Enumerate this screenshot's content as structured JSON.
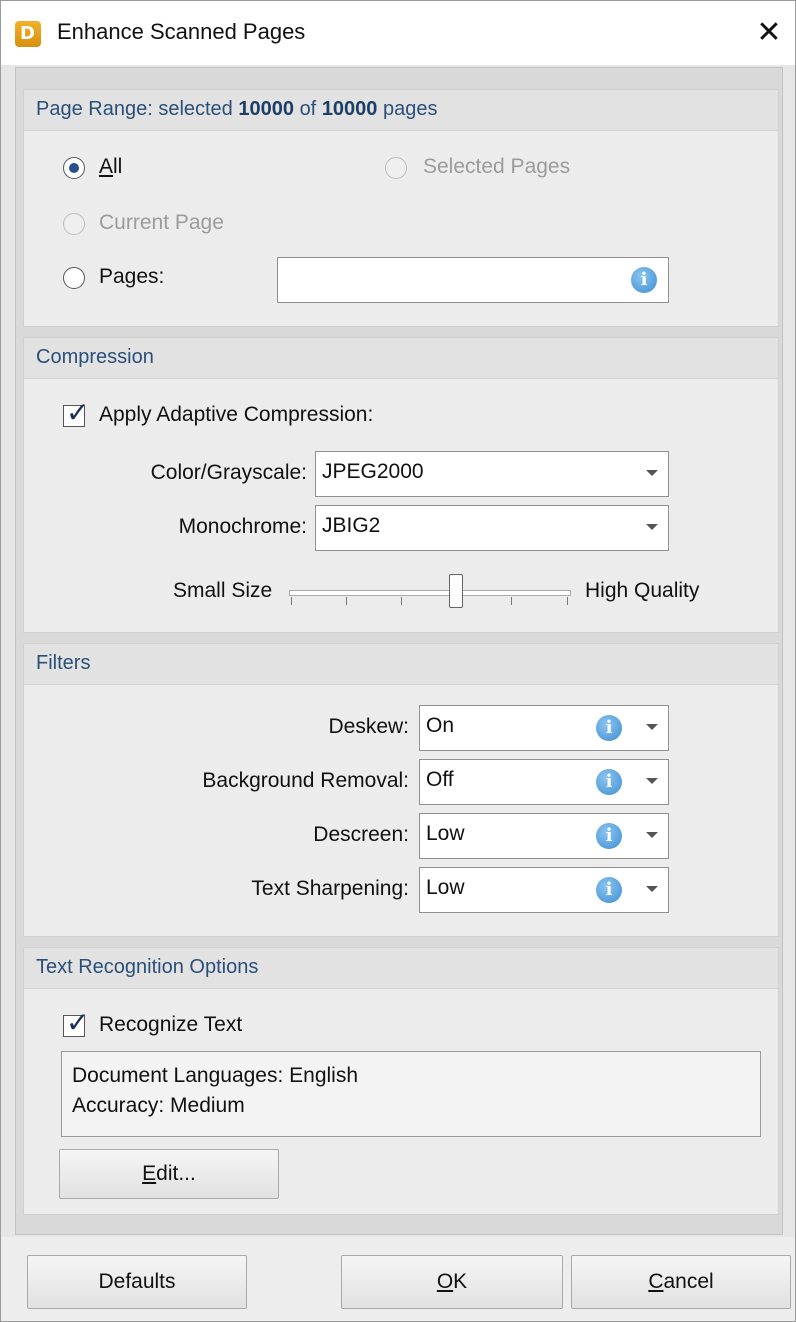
{
  "window": {
    "title": "Enhance Scanned Pages",
    "close_symbol": "✕",
    "app_icon_letter": "D"
  },
  "page_range": {
    "heading_prefix": "Page Range: selected",
    "selected": "10000",
    "of_text": "of",
    "total": "10000",
    "pages_text": "pages",
    "options": {
      "all": {
        "label": "All",
        "checked": true,
        "enabled": true
      },
      "selected_pages": {
        "label": "Selected Pages",
        "checked": false,
        "enabled": false
      },
      "current_page": {
        "label": "Current Page",
        "checked": false,
        "enabled": false
      },
      "pages": {
        "label": "Pages:",
        "checked": false,
        "enabled": true,
        "value": ""
      }
    },
    "info_symbol": "i"
  },
  "compression": {
    "heading": "Compression",
    "apply_label": "Apply Adaptive Compression:",
    "apply_checked": true,
    "color_label": "Color/Grayscale:",
    "color_value": "JPEG2000",
    "mono_label": "Monochrome:",
    "mono_value": "JBIG2",
    "slider_min_label": "Small Size",
    "slider_max_label": "High Quality",
    "slider_position": 0.6
  },
  "filters": {
    "heading": "Filters",
    "items": [
      {
        "label": "Deskew:",
        "value": "On"
      },
      {
        "label": "Background Removal:",
        "value": "Off"
      },
      {
        "label": "Descreen:",
        "value": "Low"
      },
      {
        "label": "Text Sharpening:",
        "value": "Low"
      }
    ]
  },
  "text_recognition": {
    "heading": "Text Recognition Options",
    "recognize_label": "Recognize Text",
    "recognize_checked": true,
    "summary_line1": "Document Languages: English",
    "summary_line2": "Accuracy: Medium",
    "edit_button": "Edit..."
  },
  "footer": {
    "defaults": "Defaults",
    "ok": "OK",
    "cancel": "Cancel"
  },
  "colors": {
    "group_title": "#2a4f7a",
    "info_icon": "#3d8ed3"
  }
}
